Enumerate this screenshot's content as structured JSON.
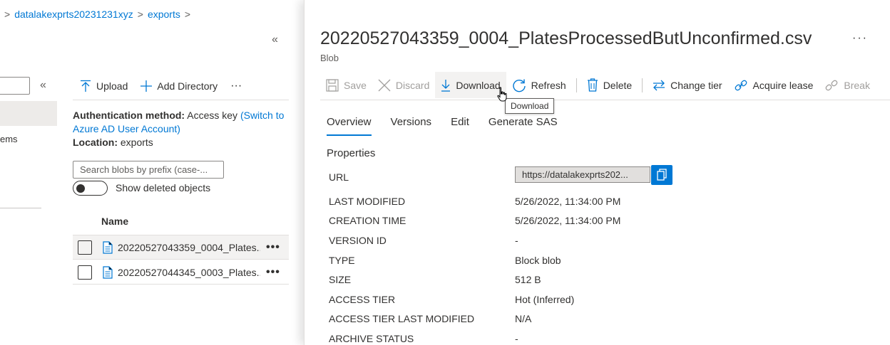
{
  "breadcrumb": {
    "account": "datalakexprts20231231xyz",
    "container": "exports"
  },
  "left": {
    "collapse_glyph": "«",
    "partial_item": "ems"
  },
  "middle": {
    "collapse_glyph": "«",
    "toolbar": {
      "upload": "Upload",
      "add_directory": "Add Directory",
      "more": "···"
    },
    "auth_label": "Authentication method:",
    "auth_value": "Access key",
    "auth_switch": "(Switch to Azure AD User Account)",
    "location_label": "Location:",
    "location_value": "exports",
    "search_placeholder": "Search blobs by prefix (case-...",
    "show_deleted": "Show deleted objects",
    "column_name": "Name",
    "files": [
      {
        "name": "20220527043359_0004_Plates..."
      },
      {
        "name": "20220527044345_0003_Plates..."
      }
    ],
    "row_more": "•••"
  },
  "panel": {
    "title": "20220527043359_0004_PlatesProcessedButUnconfirmed.csv",
    "subtitle": "Blob",
    "more": "···",
    "toolbar": {
      "save": "Save",
      "discard": "Discard",
      "download": "Download",
      "refresh": "Refresh",
      "delete": "Delete",
      "change_tier": "Change tier",
      "acquire_lease": "Acquire lease",
      "break_lease": "Break"
    },
    "tooltip": "Download",
    "tabs": [
      "Overview",
      "Versions",
      "Edit",
      "Generate SAS"
    ],
    "properties_title": "Properties",
    "properties": [
      {
        "label": "URL",
        "value": "https://datalakexprts202..."
      },
      {
        "label": "LAST MODIFIED",
        "value": "5/26/2022, 11:34:00 PM"
      },
      {
        "label": "CREATION TIME",
        "value": "5/26/2022, 11:34:00 PM"
      },
      {
        "label": "VERSION ID",
        "value": "-"
      },
      {
        "label": "TYPE",
        "value": "Block blob"
      },
      {
        "label": "SIZE",
        "value": "512 B"
      },
      {
        "label": "ACCESS TIER",
        "value": "Hot (Inferred)"
      },
      {
        "label": "ACCESS TIER LAST MODIFIED",
        "value": "N/A"
      },
      {
        "label": "ARCHIVE STATUS",
        "value": "-"
      }
    ]
  },
  "colors": {
    "accent": "#0078d4",
    "text": "#323130",
    "muted": "#605e5c",
    "disabled": "#a19f9d"
  }
}
